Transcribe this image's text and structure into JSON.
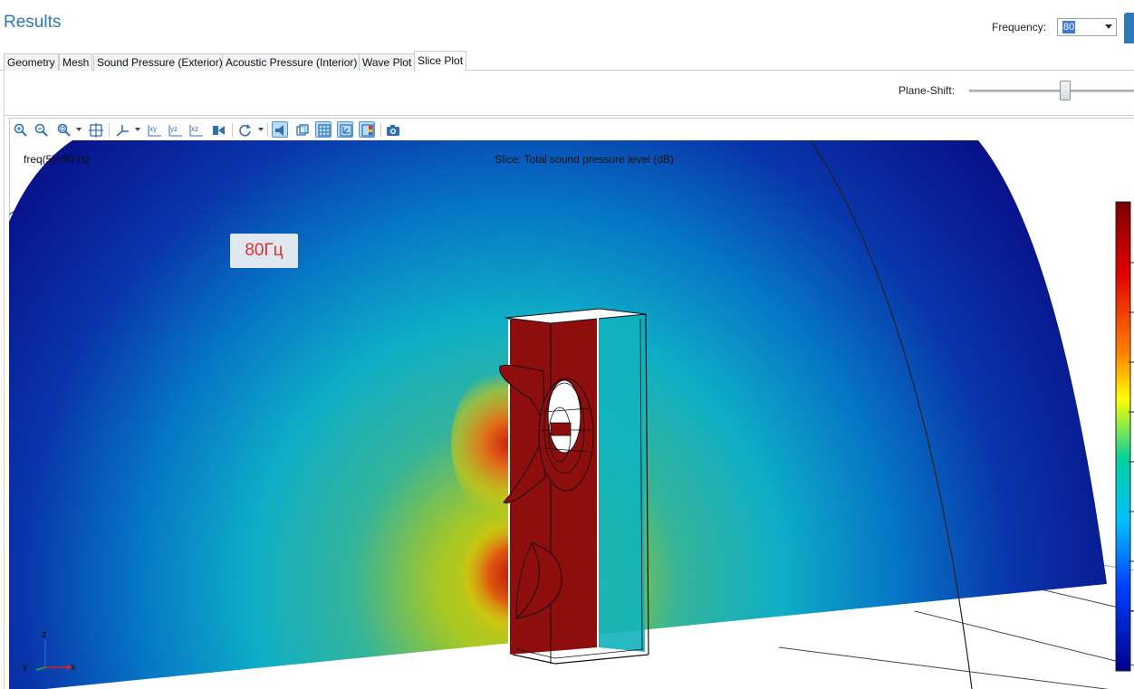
{
  "header": {
    "title": "Results",
    "frequency_label": "Frequency:",
    "frequency_value": "80"
  },
  "tabs": [
    {
      "label": "Geometry",
      "active": false
    },
    {
      "label": "Mesh",
      "active": false
    },
    {
      "label": "Sound Pressure (Exterior)",
      "active": false
    },
    {
      "label": "Acoustic Pressure (Interior)",
      "active": false
    },
    {
      "label": "Wave Plot",
      "active": false
    },
    {
      "label": "Slice Plot",
      "active": true
    }
  ],
  "controls": {
    "plane_shift_label": "Plane-Shift:",
    "plane_shift_position": 0.59
  },
  "toolbar": {
    "buttons": [
      {
        "name": "zoom-in-icon",
        "toggled": false
      },
      {
        "name": "zoom-out-icon",
        "toggled": false
      },
      {
        "name": "zoom-box-icon",
        "toggled": false,
        "dropdown": true
      },
      {
        "name": "zoom-extents-icon",
        "toggled": false
      },
      {
        "name": "axis-view-icon",
        "toggled": false,
        "dropdown": true
      },
      {
        "name": "xy-view-icon",
        "toggled": false
      },
      {
        "name": "yz-view-icon",
        "toggled": false
      },
      {
        "name": "xz-view-icon",
        "toggled": false
      },
      {
        "name": "view-direction-icon",
        "toggled": false
      },
      {
        "name": "rotate-icon",
        "toggled": false,
        "dropdown": true
      },
      {
        "name": "scene-light-icon",
        "toggled": true
      },
      {
        "name": "transparency-icon",
        "toggled": false
      },
      {
        "name": "grid-icon",
        "toggled": true
      },
      {
        "name": "axis-orientation-icon",
        "toggled": true
      },
      {
        "name": "color-legend-icon",
        "toggled": true
      },
      {
        "name": "camera-icon",
        "toggled": false
      }
    ]
  },
  "plot": {
    "freq_readout": "freq(5)=80 Hz",
    "slice_title": "Slice: Total sound pressure level (dB)",
    "badge": "80Гц",
    "axis_labels": {
      "x": "x",
      "y": "y",
      "z": "z"
    }
  },
  "colors": {
    "accent": "#2d78b8",
    "speaker_cabinet": "#8e0d0d",
    "badge_text": "#e03030"
  }
}
